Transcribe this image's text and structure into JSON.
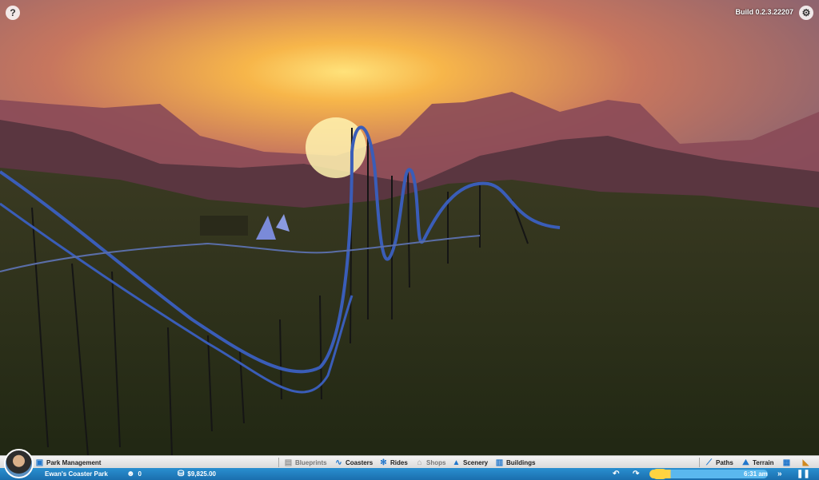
{
  "hud": {
    "help_icon": "?",
    "build": "Build 0.2.3.22207",
    "settings_icon": "⚙"
  },
  "toolbar": {
    "park_management": "Park Management",
    "blueprints": "Blueprints",
    "coasters": "Coasters",
    "rides": "Rides",
    "shops": "Shops",
    "scenery": "Scenery",
    "buildings": "Buildings",
    "paths": "Paths",
    "terrain": "Terrain"
  },
  "status": {
    "park_name": "Ewan's Coaster Park",
    "guests": "0",
    "money": "$9,825.00",
    "time": "6:31 am"
  },
  "icons": {
    "park": "park-management-icon",
    "blueprints": "blueprints-icon",
    "coasters": "coasters-icon",
    "rides": "rides-icon",
    "shops": "shops-icon",
    "scenery": "scenery-icon",
    "buildings": "buildings-icon",
    "paths": "paths-icon",
    "terrain": "terrain-icon",
    "guests": "guests-icon",
    "money": "money-icon"
  },
  "colors": {
    "toolbar_accent": "#2277cc",
    "statusbar": "#1f7fc0",
    "sun": "#ffd340"
  }
}
